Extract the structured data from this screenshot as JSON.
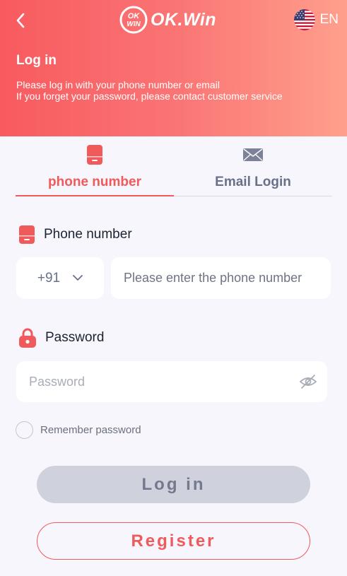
{
  "header": {
    "brand": "OK.Win",
    "badge_line1": "OK",
    "badge_line2": "WIN",
    "language": "EN",
    "title": "Log in",
    "subtitle_line1": "Please log in with your phone number or email",
    "subtitle_line2": "If you forget your password, please contact customer service"
  },
  "tabs": [
    {
      "label": "phone number",
      "icon": "phone-icon",
      "active": true
    },
    {
      "label": "Email Login",
      "icon": "mail-icon",
      "active": false
    }
  ],
  "phone": {
    "label": "Phone number",
    "country_code": "+91",
    "placeholder": "Please enter the phone number",
    "value": ""
  },
  "password": {
    "label": "Password",
    "placeholder": "Password",
    "value": ""
  },
  "remember": {
    "label": "Remember password",
    "checked": false
  },
  "buttons": {
    "login": "Log in",
    "register": "Register"
  },
  "colors": {
    "accent": "#f15a5a",
    "header_start": "#f85a5f",
    "header_end": "#ff9f8c",
    "background": "#f6f6fc",
    "login_button_bg": "#cfd1dc"
  }
}
